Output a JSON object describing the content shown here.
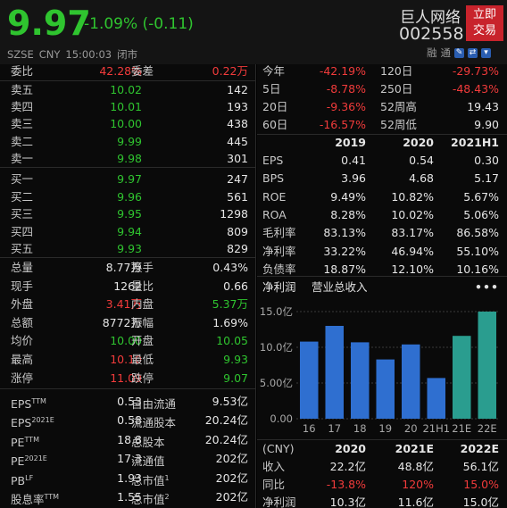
{
  "header": {
    "price": "9.97",
    "change": "-1.09% (-0.11)",
    "exchange": "SZSE",
    "currency": "CNY",
    "time": "15:00:03",
    "status": "闭市",
    "name": "巨人网络",
    "code": "002558",
    "trade_button": "立即交易",
    "tag1": "融",
    "tag2": "通"
  },
  "order_book": {
    "ratio_label": "委比",
    "ratio_value": "42.28%",
    "diff_label": "委差",
    "diff_value": "0.22万",
    "asks": [
      {
        "label": "卖五",
        "price": "10.02",
        "vol": "142"
      },
      {
        "label": "卖四",
        "price": "10.01",
        "vol": "193"
      },
      {
        "label": "卖三",
        "price": "10.00",
        "vol": "438"
      },
      {
        "label": "卖二",
        "price": "9.99",
        "vol": "445"
      },
      {
        "label": "卖一",
        "price": "9.98",
        "vol": "301"
      }
    ],
    "bids": [
      {
        "label": "买一",
        "price": "9.97",
        "vol": "247"
      },
      {
        "label": "买二",
        "price": "9.96",
        "vol": "561"
      },
      {
        "label": "买三",
        "price": "9.95",
        "vol": "1298"
      },
      {
        "label": "买四",
        "price": "9.94",
        "vol": "809"
      },
      {
        "label": "买五",
        "price": "9.93",
        "vol": "829"
      }
    ]
  },
  "stats": [
    {
      "l1": "总量",
      "v1": "8.77万",
      "l2": "换手",
      "v2": "0.43%"
    },
    {
      "l1": "现手",
      "v1": "1262",
      "l2": "量比",
      "v2": "0.66"
    },
    {
      "l1": "外盘",
      "v1": "3.41万",
      "l2": "内盘",
      "v2": "5.37万"
    },
    {
      "l1": "总额",
      "v1": "8772万",
      "l2": "振幅",
      "v2": "1.69%"
    },
    {
      "l1": "均价",
      "v1": "10.00",
      "l2": "开盘",
      "v2": "10.05"
    },
    {
      "l1": "最高",
      "v1": "10.10",
      "l2": "最低",
      "v2": "9.93"
    },
    {
      "l1": "涨停",
      "v1": "11.09",
      "l2": "跌停",
      "v2": "9.07"
    }
  ],
  "valuation": [
    {
      "l1": "EPS",
      "s1": "TTM",
      "v1": "0.53",
      "l2": "自由流通",
      "s2": "",
      "v2": "9.53亿"
    },
    {
      "l1": "EPS",
      "s1": "2021E",
      "v1": "0.58",
      "l2": "流通股本",
      "s2": "",
      "v2": "20.24亿"
    },
    {
      "l1": "PE",
      "s1": "TTM",
      "v1": "18.8",
      "l2": "总股本",
      "s2": "",
      "v2": "20.24亿"
    },
    {
      "l1": "PE",
      "s1": "2021E",
      "v1": "17.3",
      "l2": "流通值",
      "s2": "",
      "v2": "202亿"
    },
    {
      "l1": "PB",
      "s1": "LF",
      "v1": "1.93",
      "l2": "总市值",
      "s2": "1",
      "v2": "202亿"
    },
    {
      "l1": "股息率",
      "s1": "TTM",
      "v1": "1.55",
      "l2": "总市值",
      "s2": "2",
      "v2": "202亿"
    }
  ],
  "performance": [
    {
      "l1": "今年",
      "v1": "-42.19%",
      "l2": "120日",
      "v2": "-29.73%"
    },
    {
      "l1": "5日",
      "v1": "-8.78%",
      "l2": "250日",
      "v2": "-48.43%"
    },
    {
      "l1": "20日",
      "v1": "-9.36%",
      "l2": "52周高",
      "v2": "19.43"
    },
    {
      "l1": "60日",
      "v1": "-16.57%",
      "l2": "52周低",
      "v2": "9.90"
    }
  ],
  "financials": {
    "headers": [
      "2019",
      "2020",
      "2021H1"
    ],
    "rows": [
      {
        "label": "EPS",
        "values": [
          "0.41",
          "0.54",
          "0.30"
        ]
      },
      {
        "label": "BPS",
        "values": [
          "3.96",
          "4.68",
          "5.17"
        ]
      },
      {
        "label": "ROE",
        "values": [
          "9.49%",
          "10.82%",
          "5.67%"
        ]
      },
      {
        "label": "ROA",
        "values": [
          "8.28%",
          "10.02%",
          "5.06%"
        ]
      },
      {
        "label": "毛利率",
        "values": [
          "83.13%",
          "83.17%",
          "86.58%"
        ]
      },
      {
        "label": "净利率",
        "values": [
          "33.22%",
          "46.94%",
          "55.10%"
        ]
      },
      {
        "label": "负债率",
        "values": [
          "18.87%",
          "12.10%",
          "10.16%"
        ]
      }
    ]
  },
  "chart_tabs": {
    "tab1": "净利润",
    "tab2": "营业总收入",
    "more": "•••"
  },
  "chart_data": {
    "type": "bar",
    "categories": [
      "16",
      "17",
      "18",
      "19",
      "20",
      "21H1",
      "21E",
      "22E"
    ],
    "values": [
      10.8,
      13.0,
      10.7,
      8.3,
      10.4,
      5.7,
      11.6,
      15.0
    ],
    "estimate_flags": [
      false,
      false,
      false,
      false,
      false,
      false,
      true,
      true
    ],
    "ylim": [
      0,
      15
    ],
    "yticks": [
      "15.0亿",
      "10.0亿",
      "5.00亿",
      "0.00"
    ],
    "colors": {
      "actual": "#2f6fd0",
      "estimate": "#2a9d8f"
    }
  },
  "forecast": {
    "header_label": "(CNY)",
    "headers": [
      "2020",
      "2021E",
      "2022E"
    ],
    "rows": [
      {
        "label": "收入",
        "values": [
          "22.2亿",
          "48.8亿",
          "56.1亿"
        ]
      },
      {
        "label": "同比",
        "values": [
          "-13.8%",
          "120%",
          "15.0%"
        ]
      },
      {
        "label": "净利润",
        "values": [
          "10.3亿",
          "11.6亿",
          "15.0亿"
        ]
      }
    ]
  }
}
